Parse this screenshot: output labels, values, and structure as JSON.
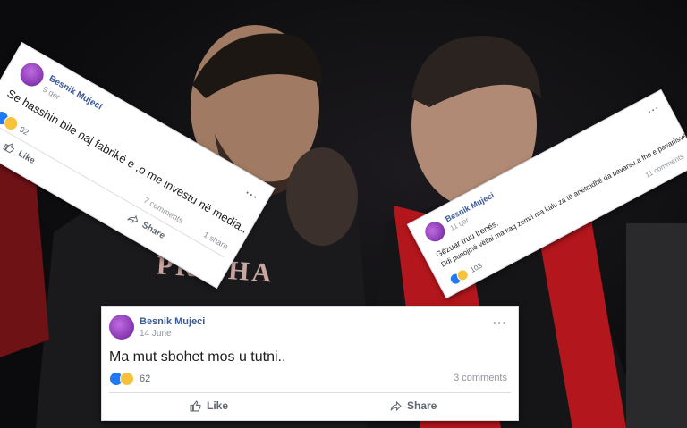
{
  "posts": [
    {
      "author": "Besnik Mujeci",
      "time": "9 qer",
      "text": "Se hasshin bile naj fabrikë e ,o me investu në media..",
      "reaction_count": "92",
      "comments": "7 comments",
      "shares": "1 share",
      "like_label": "Like",
      "share_label": "Share"
    },
    {
      "author": "Besnik Mujeci",
      "time": "11 qer",
      "text": "Gëzuar truu Irenës.",
      "text2": "Ddi punojmë vëllai ma kaq zemri ma kalu za të anëtmdhë da pavarsu,a fhe e pavariisvë.",
      "reaction_count": "103",
      "comments": "11 comments"
    },
    {
      "author": "Besnik Mujeci",
      "time": "14 June",
      "text": "Ma mut sbohet mos u tutni..",
      "reaction_count": "62",
      "comments": "3 comments",
      "like_label": "Like",
      "share_label": "Share"
    }
  ],
  "background_text": "PRISHA",
  "colors": {
    "link": "#385898",
    "like": "#2078f4",
    "flag_red": "#b3161c",
    "avatar": "#8e3bc0"
  }
}
